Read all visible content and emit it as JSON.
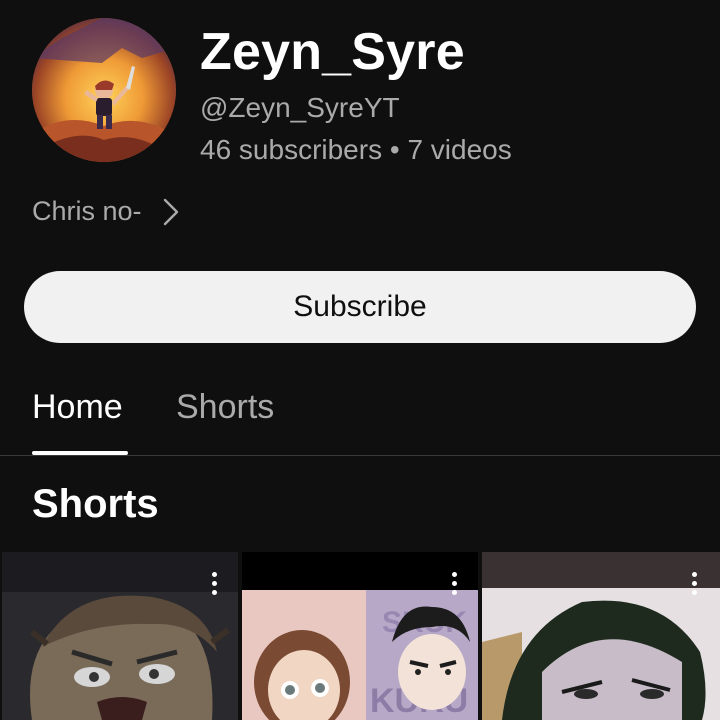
{
  "channel": {
    "name": "Zeyn_Syre",
    "handle": "@Zeyn_SyreYT",
    "stats": "46 subscribers • 7 videos",
    "description": "Chris no-"
  },
  "subscribe_label": "Subscribe",
  "tabs": [
    {
      "label": "Home",
      "selected": true
    },
    {
      "label": "Shorts",
      "selected": false
    }
  ],
  "section_title": "Shorts",
  "icons": {
    "avatar": "channel-avatar",
    "description_more": "chevron-right-icon",
    "short_menu": "more-vert-icon"
  }
}
